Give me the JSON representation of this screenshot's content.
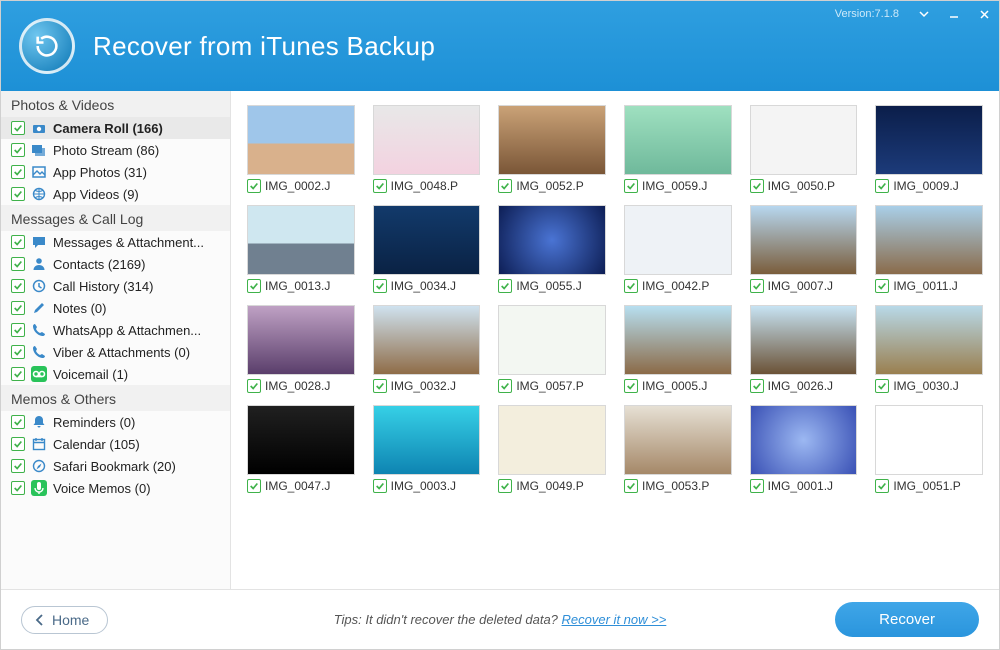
{
  "header": {
    "title": "Recover from iTunes Backup",
    "version": "Version:7.1.8"
  },
  "sidebar": {
    "sections": [
      {
        "title": "Photos & Videos",
        "items": [
          {
            "icon": "camera",
            "label": "Camera Roll (166)",
            "selected": true
          },
          {
            "icon": "stream",
            "label": "Photo Stream (86)"
          },
          {
            "icon": "photo",
            "label": "App Photos (31)"
          },
          {
            "icon": "globe",
            "label": "App Videos (9)"
          }
        ]
      },
      {
        "title": "Messages & Call Log",
        "items": [
          {
            "icon": "chat",
            "label": "Messages & Attachment..."
          },
          {
            "icon": "person",
            "label": "Contacts (2169)"
          },
          {
            "icon": "clock",
            "label": "Call History (314)"
          },
          {
            "icon": "pencil",
            "label": "Notes (0)"
          },
          {
            "icon": "phone",
            "label": "WhatsApp & Attachmen..."
          },
          {
            "icon": "phone",
            "label": "Viber & Attachments (0)"
          },
          {
            "icon": "voicemail",
            "label": "Voicemail (1)",
            "greenIcon": true
          }
        ]
      },
      {
        "title": "Memos & Others",
        "items": [
          {
            "icon": "bell",
            "label": "Reminders (0)"
          },
          {
            "icon": "calendar",
            "label": "Calendar (105)"
          },
          {
            "icon": "compass",
            "label": "Safari Bookmark (20)"
          },
          {
            "icon": "mic",
            "label": "Voice Memos (0)",
            "greenIcon": true
          }
        ]
      }
    ]
  },
  "thumbnails": [
    {
      "label": "IMG_0002.J",
      "cls": "g1"
    },
    {
      "label": "IMG_0048.P",
      "cls": "g2"
    },
    {
      "label": "IMG_0052.P",
      "cls": "g3"
    },
    {
      "label": "IMG_0059.J",
      "cls": "g4"
    },
    {
      "label": "IMG_0050.P",
      "cls": "g5"
    },
    {
      "label": "IMG_0009.J",
      "cls": "g6"
    },
    {
      "label": "IMG_0013.J",
      "cls": "g7"
    },
    {
      "label": "IMG_0034.J",
      "cls": "g8"
    },
    {
      "label": "IMG_0055.J",
      "cls": "g9"
    },
    {
      "label": "IMG_0042.P",
      "cls": "g10"
    },
    {
      "label": "IMG_0007.J",
      "cls": "g11"
    },
    {
      "label": "IMG_0011.J",
      "cls": "g12"
    },
    {
      "label": "IMG_0028.J",
      "cls": "g13"
    },
    {
      "label": "IMG_0032.J",
      "cls": "g14"
    },
    {
      "label": "IMG_0057.P",
      "cls": "g15"
    },
    {
      "label": "IMG_0005.J",
      "cls": "g16"
    },
    {
      "label": "IMG_0026.J",
      "cls": "g17"
    },
    {
      "label": "IMG_0030.J",
      "cls": "g18"
    },
    {
      "label": "IMG_0047.J",
      "cls": "g19"
    },
    {
      "label": "IMG_0003.J",
      "cls": "g20"
    },
    {
      "label": "IMG_0049.P",
      "cls": "g21"
    },
    {
      "label": "IMG_0053.P",
      "cls": "g22"
    },
    {
      "label": "IMG_0001.J",
      "cls": "g23"
    },
    {
      "label": "IMG_0051.P",
      "cls": "g24"
    }
  ],
  "footer": {
    "home": "Home",
    "tips_prefix": "Tips: It didn't recover the deleted data? ",
    "tips_link": "Recover it now >>",
    "recover": "Recover"
  }
}
